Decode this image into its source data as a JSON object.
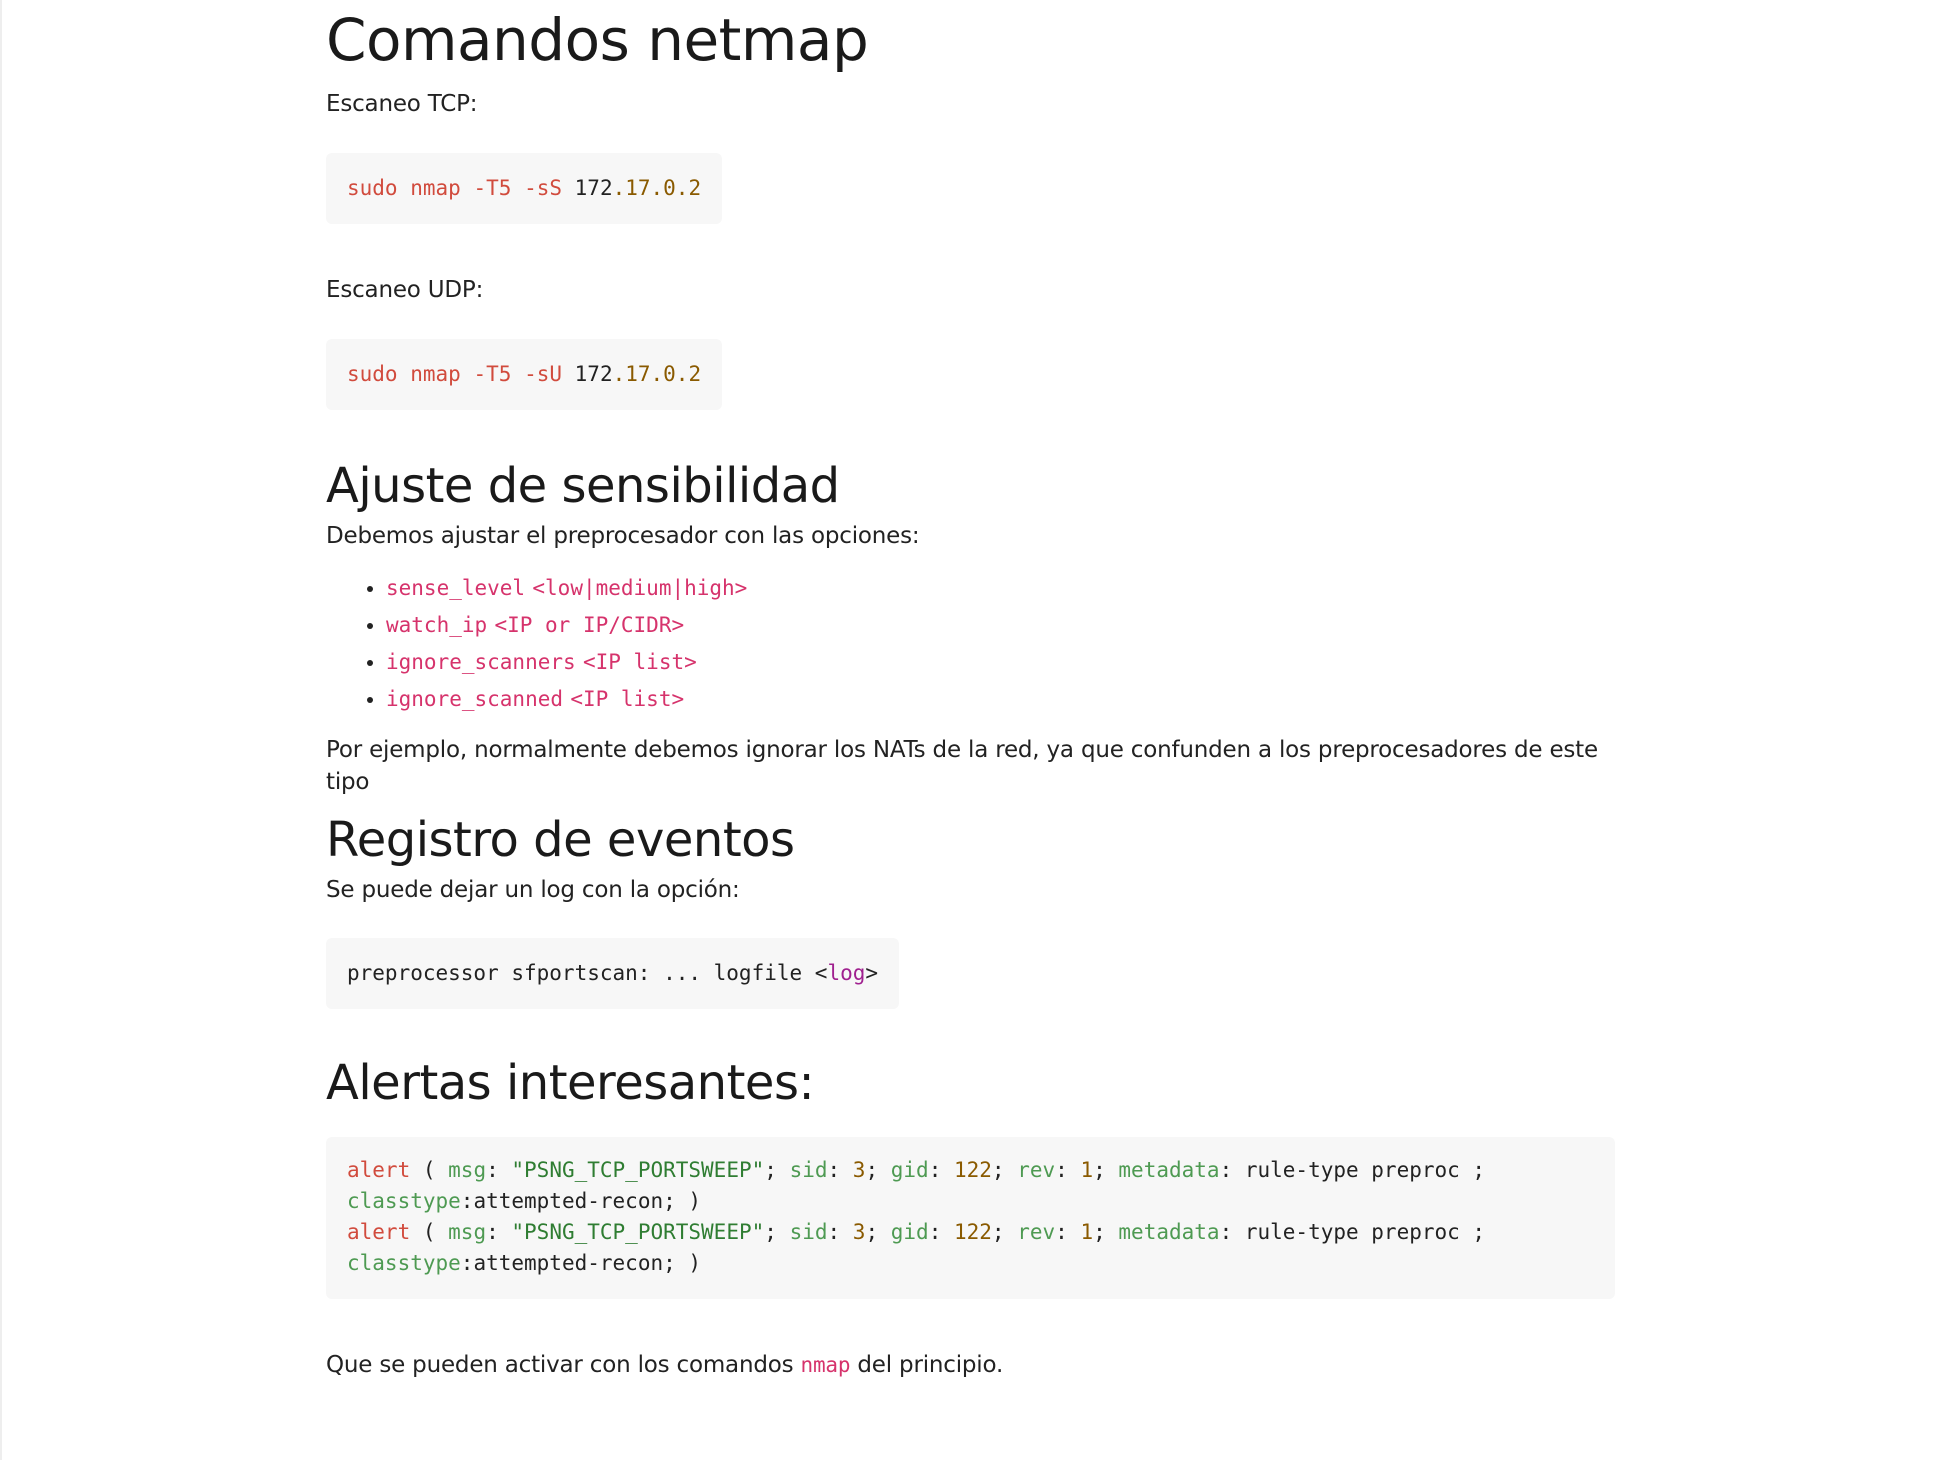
{
  "title": "Comandos netmap",
  "tcp_label": "Escaneo TCP:",
  "tcp_cmd": {
    "sudo": "sudo",
    "nmap": "nmap",
    "t5": "-T5",
    "flag": "-sS",
    "ip_a": "172",
    "ip_b": ".17.0.2"
  },
  "udp_label": "Escaneo UDP:",
  "udp_cmd": {
    "sudo": "sudo",
    "nmap": "nmap",
    "t5": "-T5",
    "flag": "-sU",
    "ip_a": "172",
    "ip_b": ".17.0.2"
  },
  "sens_heading": "Ajuste de sensibilidad",
  "sens_intro": "Debemos ajustar el preprocesador con las opciones:",
  "options": [
    {
      "name": "sense_level",
      "value": "<low|medium|high>"
    },
    {
      "name": "watch_ip",
      "value": "<IP or IP/CIDR>"
    },
    {
      "name": "ignore_scanners",
      "value": "<IP list>"
    },
    {
      "name": "ignore_scanned",
      "value": "<IP list>"
    }
  ],
  "nat_note": "Por ejemplo, normalmente debemos ignorar los NATs de la red, ya que confunden a los preprocesadores de este tipo",
  "log_heading": "Registro de eventos",
  "log_intro": "Se puede dejar un log con la opción:",
  "log_cmd": {
    "prefix": "preprocessor sfportscan: ... logfile <",
    "tag": "log",
    "suffix": ">"
  },
  "alerts_heading": "Alertas interesantes:",
  "alert_line": {
    "alert": "alert",
    "open": " ( ",
    "msg_key": "msg",
    "msg_val": "\"PSNG_TCP_PORTSWEEP\"",
    "sid_key": "sid",
    "sid_val": "3",
    "gid_key": "gid",
    "gid_val": "122",
    "rev_key": "rev",
    "rev_val": "1",
    "meta_key": "metadata",
    "meta_val": "rule-type preproc ;",
    "class_key": "classtype",
    "class_val": "attempted-recon; )"
  },
  "closing": {
    "before": "Que se pueden activar con los comandos ",
    "code": "nmap",
    "after": " del principio."
  }
}
